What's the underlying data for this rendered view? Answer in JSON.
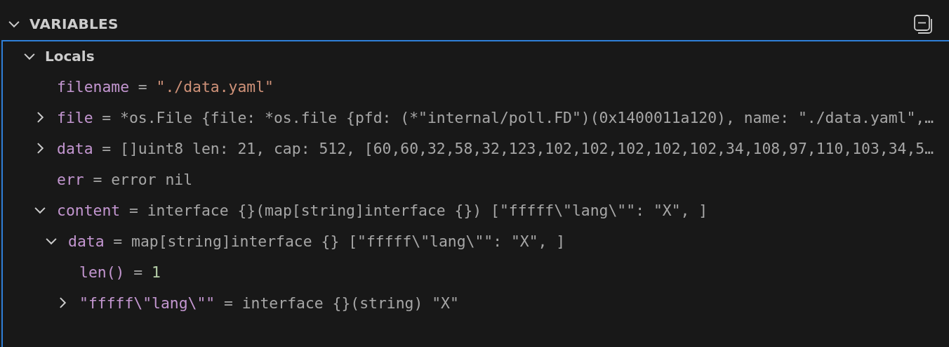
{
  "panel": {
    "title": "VARIABLES",
    "expanded": true
  },
  "scopes": [
    {
      "label": "Locals",
      "expanded": true,
      "variables": [
        {
          "kind": "leaf",
          "name": "filename",
          "sep": "=",
          "value": {
            "kind": "string",
            "text": "\"./data.yaml\""
          }
        },
        {
          "kind": "node",
          "expanded": false,
          "name": "file",
          "sep": "=",
          "value": {
            "kind": "plain",
            "text": "*os.File {file: *os.file {pfd: (*\"internal/poll.FD\")(0x1400011a120), name: \"./data.yaml\",…"
          }
        },
        {
          "kind": "node",
          "expanded": false,
          "name": "data",
          "sep": "=",
          "value": {
            "kind": "plain",
            "text": "[]uint8 len: 21, cap: 512, [60,60,32,58,32,123,102,102,102,102,102,34,108,97,110,103,34,5…"
          }
        },
        {
          "kind": "leaf",
          "name": "err",
          "sep": "=",
          "value": {
            "kind": "plain",
            "text": "error nil"
          }
        },
        {
          "kind": "node",
          "expanded": true,
          "name": "content",
          "sep": "=",
          "value": {
            "kind": "plain",
            "text": "interface {}(map[string]interface {}) [\"fffff\\\"lang\\\"\": \"X\", ]"
          },
          "children": [
            {
              "kind": "node",
              "expanded": true,
              "name": "data",
              "sep": "=",
              "value": {
                "kind": "plain",
                "text": "map[string]interface {} [\"fffff\\\"lang\\\"\": \"X\", ]"
              },
              "children": [
                {
                  "kind": "leaf",
                  "name": "len()",
                  "sep": "=",
                  "value": {
                    "kind": "number",
                    "text": "1"
                  }
                },
                {
                  "kind": "node",
                  "expanded": false,
                  "name": "\"fffff\\\"lang\\\"\"",
                  "sep": "=",
                  "value": {
                    "kind": "plain",
                    "text": "interface {}(string) \"X\""
                  }
                }
              ]
            }
          ]
        }
      ]
    }
  ]
}
